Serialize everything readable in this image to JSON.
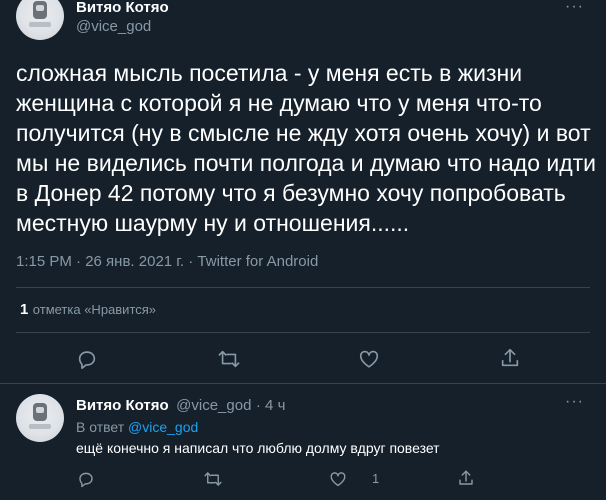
{
  "main_tweet": {
    "author_name": "Витяо Котяо",
    "author_handle": "@vice_god",
    "more_label": "···",
    "text_lines": [
      "сложная мысль посетила - у меня есть в жизни",
      "женщина с которой я не думаю что у меня что-то",
      "получится (ну в смысле не жду хотя очень хочу) и вот",
      "мы не виделись почти полгода и думаю что надо идти",
      "в Донер 42 потому что я безумно хочу попробовать",
      "местную шаурму ну и отношения......"
    ],
    "timestamp": "1:15 PM · 26 янв. 2021 г. · Twitter for Android",
    "likes_count": "1",
    "likes_label": "отметка «Нравится»",
    "actions": [
      "reply-icon",
      "retweet-icon",
      "like-icon",
      "share-icon"
    ]
  },
  "reply_tweet": {
    "author_name": "Витяо Котяо",
    "author_handle": "@vice_god",
    "age": "· 4 ч",
    "more_label": "···",
    "reply_prefix": "В ответ",
    "reply_to": "@vice_god",
    "text": "ещё конечно я написал что люблю долму вдруг повезет",
    "like_count": "1"
  },
  "theme": {
    "background": "#15202b",
    "text": "#ffffff",
    "secondary": "#8899a6",
    "accent": "#1da1f2",
    "divider": "#38444d"
  }
}
